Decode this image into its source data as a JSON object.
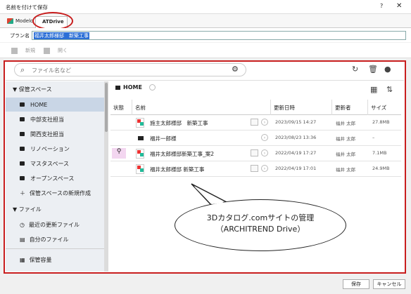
{
  "window": {
    "title": "名前を付けて保存",
    "help": "?",
    "close": "✕"
  },
  "tabs": [
    {
      "label": "Modelo"
    },
    {
      "label": "ATDrive"
    }
  ],
  "plan": {
    "label": "プラン名",
    "value": "福井太郎様邸　新築工事"
  },
  "toolbar": {
    "new_label": "新規",
    "open_label": "開く"
  },
  "search": {
    "placeholder": "ファイル名など"
  },
  "sidebar": {
    "storage_header": "▼ 保管スペース",
    "items": [
      {
        "label": "HOME"
      },
      {
        "label": "中部支社担当"
      },
      {
        "label": "関西支社担当"
      },
      {
        "label": "リノベーション"
      },
      {
        "label": "マスタスペース"
      },
      {
        "label": "オープンスペース"
      }
    ],
    "new_storage": "保管スペースの新規作成",
    "file_header": "▼ ファイル",
    "recent": "最近の更新ファイル",
    "mine": "自分のファイル",
    "capacity": "保管容量"
  },
  "breadcrumb": {
    "label": "HOME"
  },
  "table": {
    "headers": {
      "status": "状態",
      "name": "名前",
      "updated": "更新日時",
      "updater": "更新者",
      "size": "サイズ"
    },
    "rows": [
      {
        "type": "plan",
        "name": "施主太郎様邸　新築工事",
        "date": "2023/09/15 14:27",
        "user": "福井 太郎",
        "size": "27.8MB"
      },
      {
        "type": "folder",
        "name": "福井一郎様",
        "date": "2023/08/23 13:36",
        "user": "福井 太郎",
        "size": "–"
      },
      {
        "type": "plan",
        "status": "key",
        "name": "福井太郎様邸新築工事_案2",
        "date": "2022/04/19 17:27",
        "user": "福井 太郎",
        "size": "7.1MB"
      },
      {
        "type": "plan",
        "name": "福井太郎様邸 新築工事",
        "date": "2022/04/19 17:01",
        "user": "福井 太郎",
        "size": "24.9MB"
      }
    ]
  },
  "callout": {
    "line1": "3Dカタログ.comサイトの管理",
    "line2": "（ARCHITREND Drive）"
  },
  "footer": {
    "save_label": "保存",
    "cancel_label": "キャンセル"
  }
}
